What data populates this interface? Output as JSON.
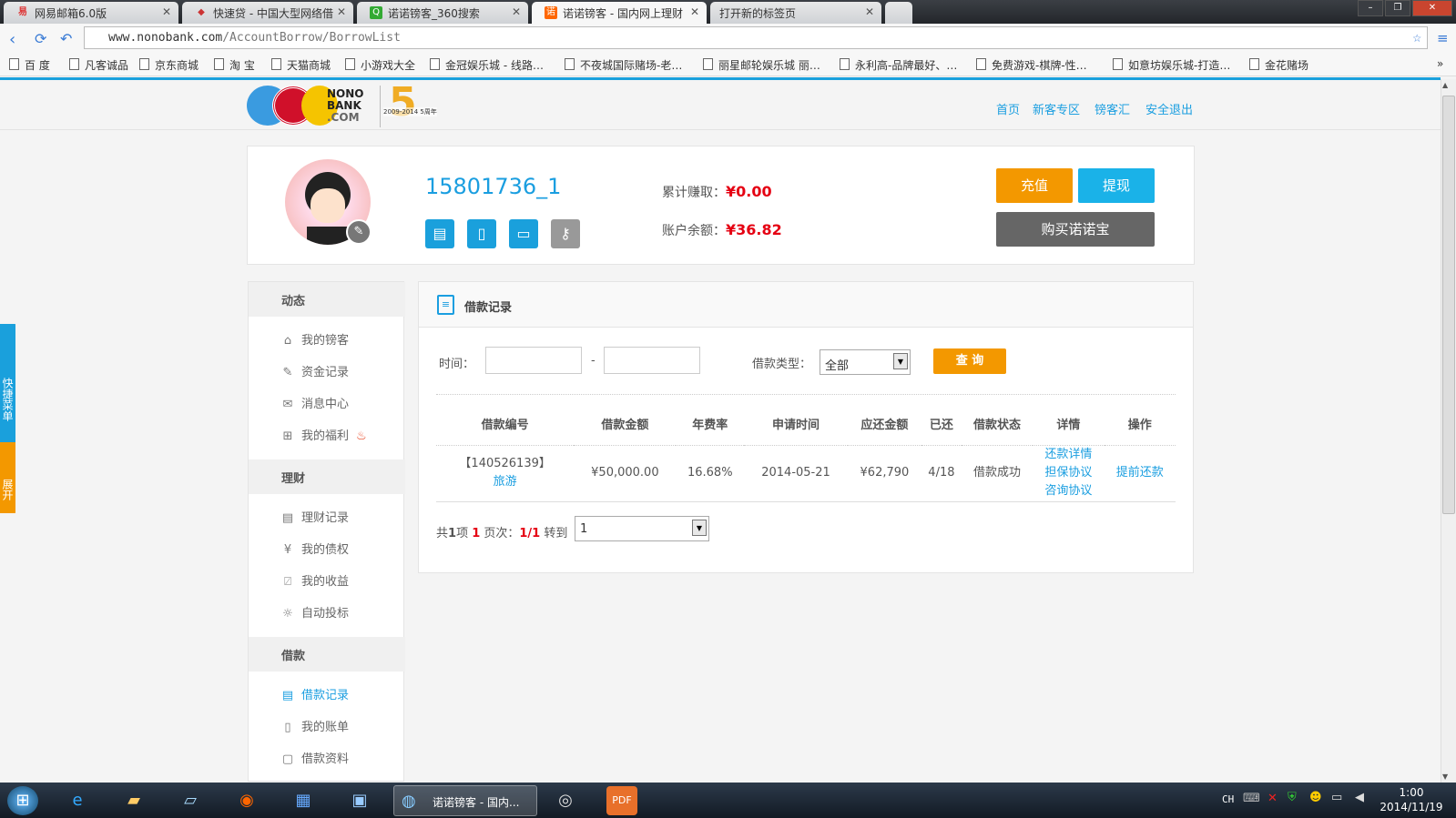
{
  "browser": {
    "tabs": [
      {
        "label": "网易邮箱6.0版",
        "icon": "mail-icon",
        "color": "#d33"
      },
      {
        "label": "快速贷 - 中国大型网络借",
        "icon": "diamond-icon",
        "color": "#c33"
      },
      {
        "label": "诺诺镑客_360搜索",
        "icon": "search-icon",
        "color": "#3a3"
      },
      {
        "label": "诺诺镑客 - 国内网上理财",
        "icon": "nono-icon",
        "color": "#f60"
      },
      {
        "label": "打开新的标签页",
        "icon": "",
        "color": ""
      }
    ],
    "url_host": "www.nonobank.com",
    "url_path": "/AccountBorrow/BorrowList",
    "bookmarks": [
      "百 度",
      "凡客诚品",
      "京东商城",
      "淘 宝",
      "天猫商城",
      "小游戏大全",
      "金冠娱乐城 - 线路…",
      "不夜城国际赌场-老…",
      "丽星邮轮娱乐城 丽…",
      "永利高-品牌最好、…",
      "免费游戏-棋牌-性…",
      "如意坊娱乐城-打造…",
      "金花赌场"
    ],
    "more": "»"
  },
  "site": {
    "logo": "NONO BANK .COM",
    "anniversary": "2009-2014 5周年",
    "nav": [
      "首页",
      "新客专区",
      "镑客汇",
      "安全退出"
    ]
  },
  "profile": {
    "username": "15801736_1",
    "earned_label": "累计赚取：",
    "earned": "¥0.00",
    "balance_label": "账户余额：",
    "balance": "¥36.82",
    "recharge": "充值",
    "withdraw": "提现",
    "buy": "购买诺诺宝"
  },
  "sidebar": {
    "sections": [
      {
        "title": "动态",
        "items": [
          {
            "label": "我的镑客",
            "icon": "home-icon"
          },
          {
            "label": "资金记录",
            "icon": "ledger-icon"
          },
          {
            "label": "消息中心",
            "icon": "mail-icon"
          },
          {
            "label": "我的福利",
            "icon": "gift-icon"
          }
        ]
      },
      {
        "title": "理财",
        "items": [
          {
            "label": "理财记录",
            "icon": "document-icon"
          },
          {
            "label": "我的债权",
            "icon": "yen-icon"
          },
          {
            "label": "我的收益",
            "icon": "chart-icon"
          },
          {
            "label": "自动投标",
            "icon": "bulb-icon"
          }
        ]
      },
      {
        "title": "借款",
        "items": [
          {
            "label": "借款记录",
            "icon": "list-icon"
          },
          {
            "label": "我的账单",
            "icon": "bill-icon"
          },
          {
            "label": "借款资料",
            "icon": "clipboard-icon"
          }
        ]
      }
    ]
  },
  "main": {
    "title": "借款记录",
    "time_label": "时间：",
    "dash": "-",
    "type_label": "借款类型：",
    "type_value": "全部",
    "query": "查 询",
    "columns": [
      "借款编号",
      "借款金额",
      "年费率",
      "申请时间",
      "应还金额",
      "已还",
      "借款状态",
      "详情",
      "操作"
    ],
    "rows": [
      {
        "id": "【140526139】",
        "purpose": "旅游",
        "amount": "¥50,000.00",
        "rate": "16.68%",
        "date": "2014-05-21",
        "due": "¥62,790",
        "paid": "4/18",
        "status": "借款成功",
        "details": [
          "还款详情",
          "担保协议",
          "咨询协议"
        ],
        "action": "提前还款"
      }
    ],
    "pager": {
      "p1": "共",
      "count": "1",
      "p2": "项 ",
      "page": "1",
      "p3": " 页次：",
      "cur": "1/1",
      "p4": " 转到",
      "jump": "1"
    }
  },
  "quick_menu": {
    "top": "快捷菜单",
    "bottom": "展开"
  },
  "taskbar": {
    "active_window": "诺诺镑客 - 国内...",
    "lang": "CH",
    "time": "1:00",
    "date": "2014/11/19"
  }
}
